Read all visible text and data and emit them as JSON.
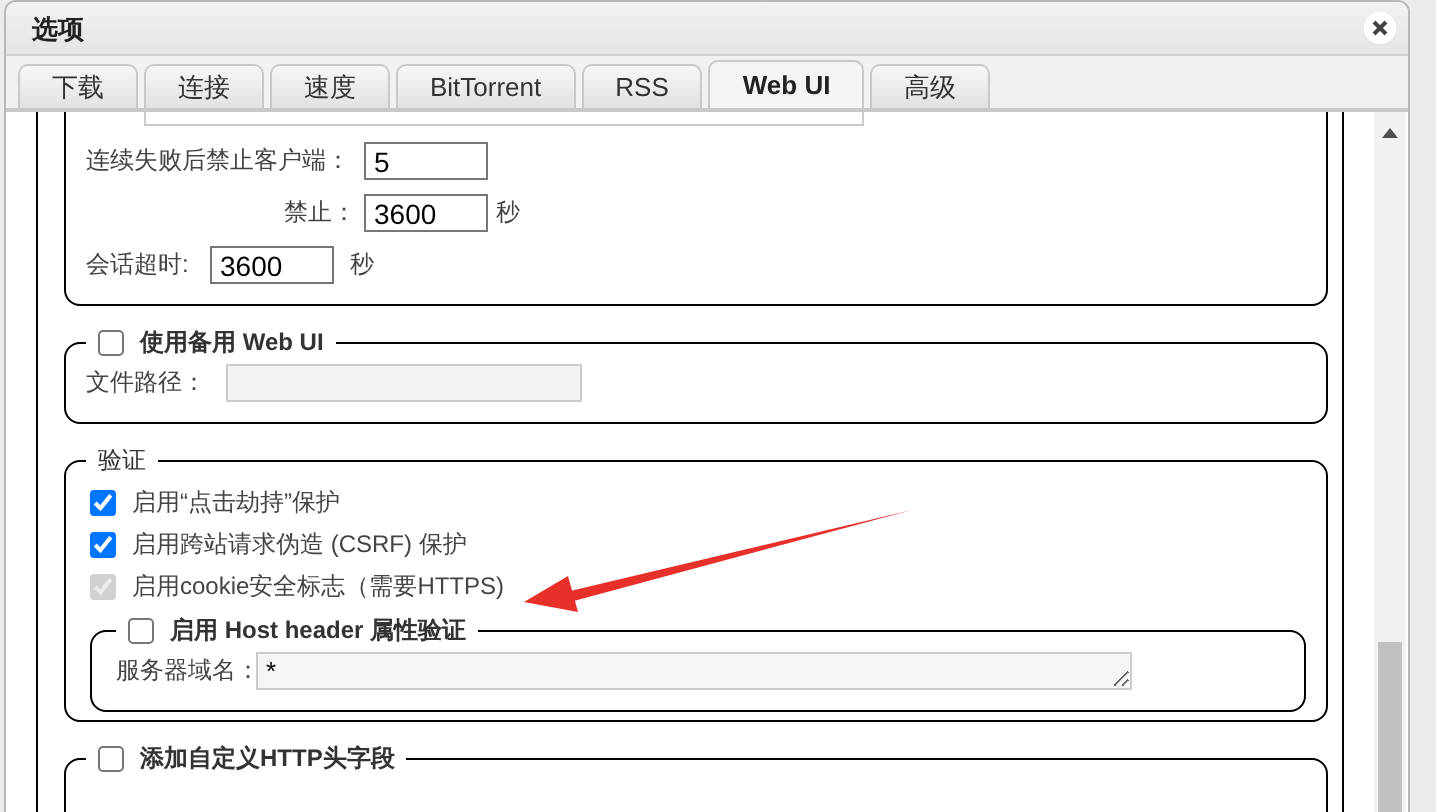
{
  "dialog": {
    "title": "选项"
  },
  "tabs": [
    {
      "label": "下载",
      "selected": false
    },
    {
      "label": "连接",
      "selected": false
    },
    {
      "label": "速度",
      "selected": false
    },
    {
      "label": "BitTorrent",
      "selected": false
    },
    {
      "label": "RSS",
      "selected": false
    },
    {
      "label": "Web UI",
      "selected": true
    },
    {
      "label": "高级",
      "selected": false
    }
  ],
  "ban": {
    "fail_label": "连续失败后禁止客户端：",
    "fail_value": "5",
    "ban_label": "禁止：",
    "ban_value": "3600",
    "ban_unit": "秒",
    "session_label": "会话超时:",
    "session_value": "3600",
    "session_unit": "秒"
  },
  "alt_webui": {
    "label": "使用备用 Web UI",
    "checked": false,
    "path_label": "文件路径：",
    "path_disabled": true
  },
  "auth": {
    "legend": "验证",
    "options": [
      {
        "label": "启用“点击劫持”保护",
        "checked": true,
        "disabled": false
      },
      {
        "label": "启用跨站请求伪造 (CSRF) 保护",
        "checked": true,
        "disabled": false
      },
      {
        "label": "启用cookie安全标志（需要HTTPS)",
        "checked": true,
        "disabled": true
      }
    ],
    "host_header": {
      "label": "启用 Host header 属性验证",
      "checked": false,
      "domain_label": "服务器域名：",
      "domain_value": "*"
    }
  },
  "custom_headers": {
    "label": "添加自定义HTTP头字段",
    "checked": false
  }
}
